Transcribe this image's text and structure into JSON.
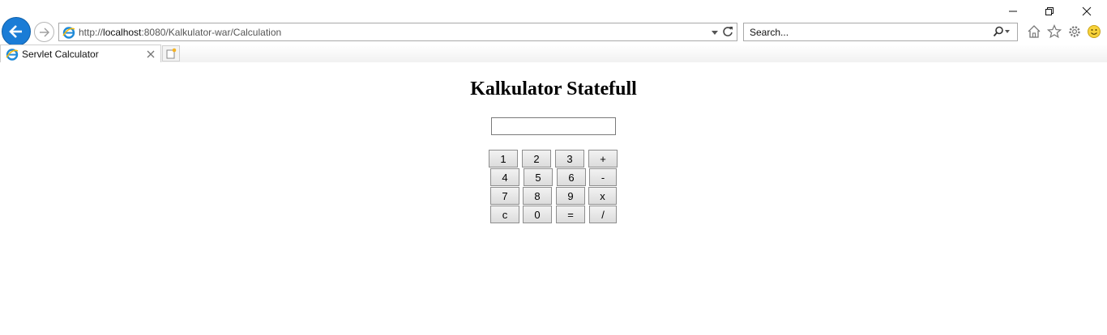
{
  "browser": {
    "address": {
      "scheme": "http://",
      "host": "localhost",
      "path": ":8080/Kalkulator-war/Calculation"
    },
    "search": {
      "placeholder": "Search..."
    },
    "tab": {
      "title": "Servlet Calculator"
    }
  },
  "page": {
    "title": "Kalkulator Statefull",
    "display_value": "",
    "keypad": [
      [
        "1",
        "2",
        "3",
        "+"
      ],
      [
        "4",
        "5",
        "6",
        "-"
      ],
      [
        "7",
        "8",
        "9",
        "x"
      ],
      [
        "c",
        "0",
        "=",
        "/"
      ]
    ]
  }
}
